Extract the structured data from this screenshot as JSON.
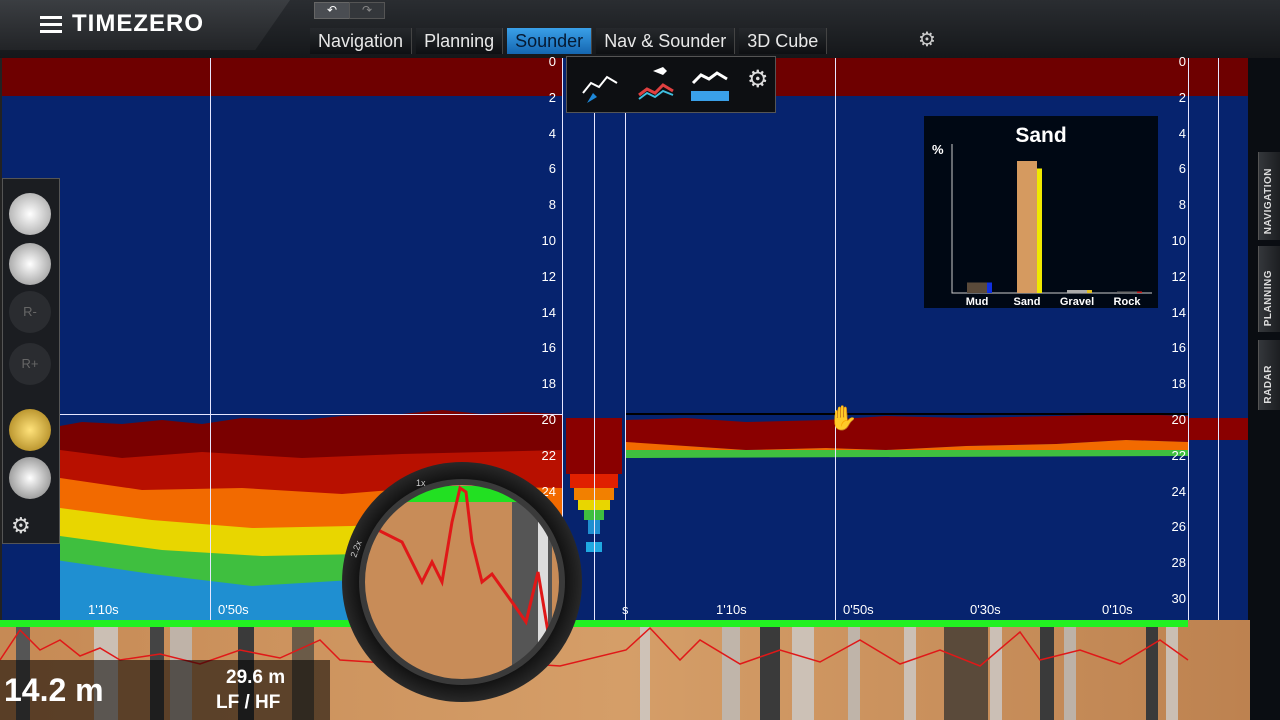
{
  "app": {
    "logo": "TIMEZERO"
  },
  "toolbar": {
    "undo_label": "↶",
    "redo_label": "↷"
  },
  "tabs": [
    {
      "label": "Navigation",
      "active": false
    },
    {
      "label": "Planning",
      "active": false
    },
    {
      "label": "Sounder",
      "active": true
    },
    {
      "label": "Nav & Sounder",
      "active": false
    },
    {
      "label": "3D Cube",
      "active": false
    }
  ],
  "side_tabs": [
    "NAVIGATION",
    "PLANNING",
    "RADAR"
  ],
  "depth_scale": [
    "0",
    "2",
    "4",
    "6",
    "8",
    "10",
    "12",
    "14",
    "16",
    "18",
    "20",
    "22",
    "24",
    "26",
    "28",
    "30"
  ],
  "time_labels": {
    "left": [
      "1'10s",
      "0'50s"
    ],
    "right": [
      "1'10s",
      "0'50s",
      "0'30s",
      "0'10s"
    ],
    "split": "s"
  },
  "readouts": {
    "depth": "14.2 m",
    "range": "29.6 m",
    "frequency": "LF / HF"
  },
  "magnifier_scale": {
    "top": "1x",
    "side": "2.2x"
  },
  "left_tools": [
    {
      "icon": "boat-icon"
    },
    {
      "icon": "zoom-tool-icon"
    },
    {
      "icon": "range-minus-icon",
      "label": "R-"
    },
    {
      "icon": "range-plus-icon",
      "label": "R+"
    },
    {
      "icon": "hand-icon"
    },
    {
      "icon": "marker-icon"
    },
    {
      "icon": "gears-icon"
    }
  ],
  "colors": {
    "accent": "#1e88d8",
    "water": "#06236e",
    "bottom_red": "#7a0000",
    "ground_green": "#22f022"
  },
  "chart_data": {
    "type": "bar",
    "title": "Sand",
    "ylabel": "%",
    "categories": [
      "Mud",
      "Sand",
      "Gravel",
      "Rock"
    ],
    "values": [
      7,
      88,
      2,
      1
    ],
    "secondary_values": [
      7,
      83,
      2,
      1
    ],
    "ylim": [
      0,
      100
    ]
  }
}
